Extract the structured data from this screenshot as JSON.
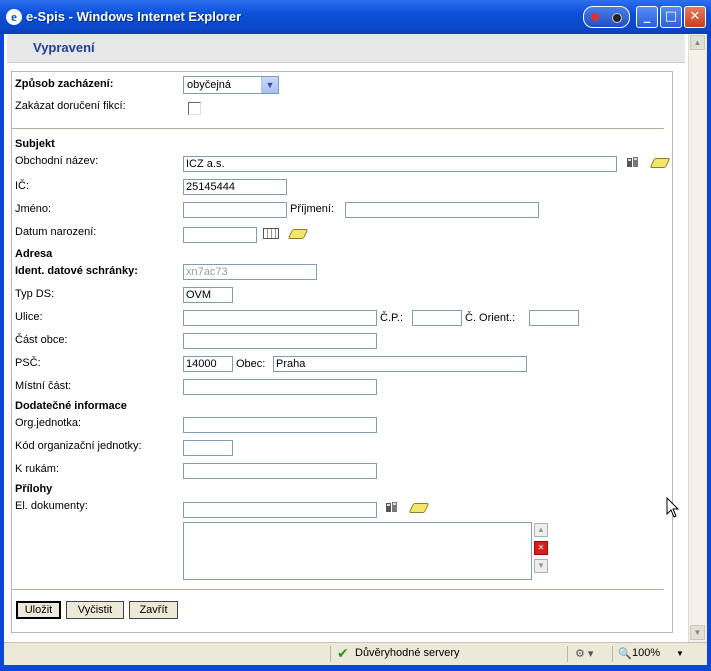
{
  "window": {
    "title": "e-Spis - Windows Internet Explorer",
    "icon_glyph": "e"
  },
  "page": {
    "title": "Vypravení"
  },
  "form": {
    "zpusob_label": "Způsob zacházení:",
    "zpusob_value": "obyčejná",
    "zakazat_label": "Zakázat doručení fikcí:",
    "zakazat_checked": false,
    "subjekt_heading": "Subjekt",
    "obchodni_label": "Obchodní název:",
    "obchodni_value": "ICZ a.s.",
    "ic_label": "IČ:",
    "ic_value": "25145444",
    "jmeno_label": "Jméno:",
    "jmeno_value": "",
    "prijmeni_label": "Příjmení:",
    "prijmeni_value": "",
    "datum_label": "Datum narození:",
    "datum_value": "",
    "adresa_heading": "Adresa",
    "ident_label": "Ident. datové schránky:",
    "ident_value": "xn7ac73",
    "typds_label": "Typ DS:",
    "typds_value": "OVM",
    "ulice_label": "Ulice:",
    "ulice_value": "",
    "cp_label": "Č.P.:",
    "cp_value": "",
    "corient_label": "Č. Orient.:",
    "corient_value": "",
    "castobce_label": "Část obce:",
    "castobce_value": "",
    "psc_label": "PSČ:",
    "psc_value": "14000",
    "obec_label": "Obec:",
    "obec_value": "Praha",
    "mistni_label": "Místní část:",
    "mistni_value": "",
    "dodatecne_heading": "Dodatečné informace",
    "org_label": "Org.jednotka:",
    "org_value": "",
    "kod_label": "Kód organizační jednotky:",
    "kod_value": "",
    "krukam_label": "K rukám:",
    "krukam_value": "",
    "prilohy_heading": "Přílohy",
    "eldok_label": "El. dokumenty:",
    "eldok_value": ""
  },
  "buttons": {
    "ulozit": "Uložit",
    "vycistit": "Vyčistit",
    "zavrit": "Zavřít"
  },
  "status": {
    "zone": "Důvěryhodné servery",
    "zoom": "100%"
  },
  "colors": {
    "title_blue": "#1f3f9b",
    "xp_titlebar": "#0a50d8"
  }
}
